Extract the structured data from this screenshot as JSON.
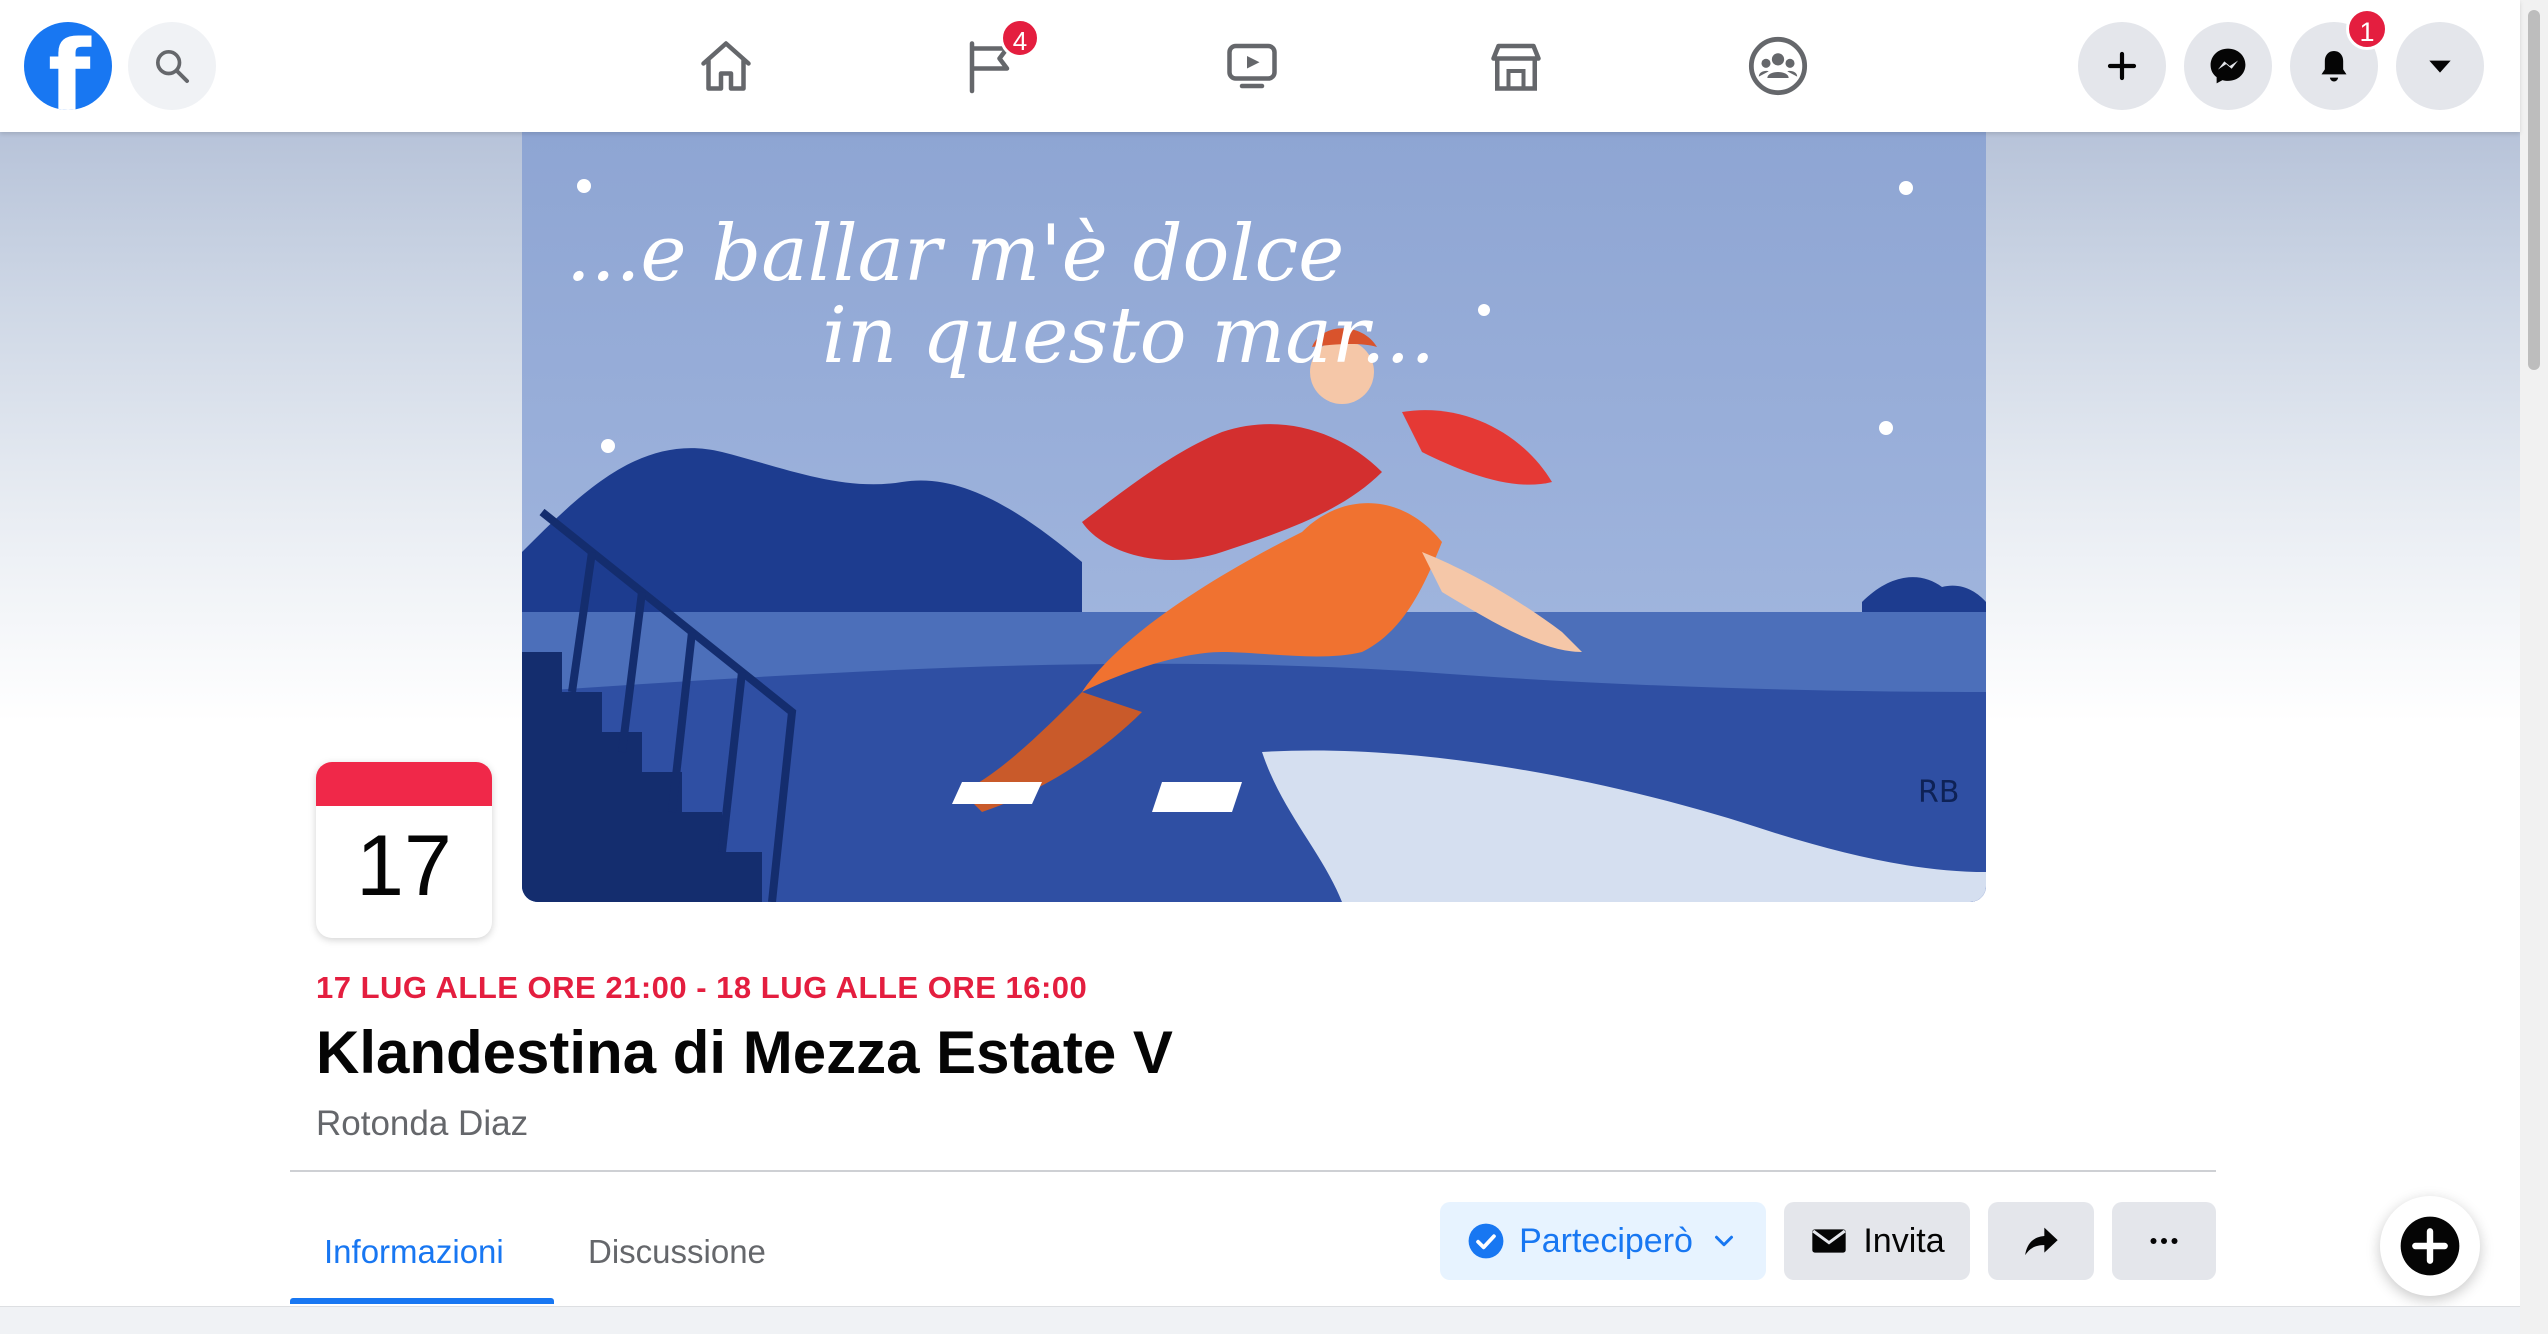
{
  "nav": {
    "pages_badge": "4",
    "notifications_badge": "1"
  },
  "event": {
    "date_day": "17",
    "when": "17 LUG ALLE ORE 21:00 - 18 LUG ALLE ORE 16:00",
    "title": "Klandestina di Mezza Estate V",
    "place": "Rotonda Diaz"
  },
  "cover": {
    "text_line1": "...e ballar m'è dolce",
    "text_line2": "in questo mar...",
    "signature": "RB"
  },
  "tabs": [
    {
      "label": "Informazioni"
    },
    {
      "label": "Discussione"
    }
  ],
  "actions": {
    "going_label": "Parteciperò",
    "invite_label": "Invita"
  },
  "colors": {
    "accent": "#1877f2",
    "date_red": "#e41e3f",
    "going_bg": "#e7f3ff"
  }
}
